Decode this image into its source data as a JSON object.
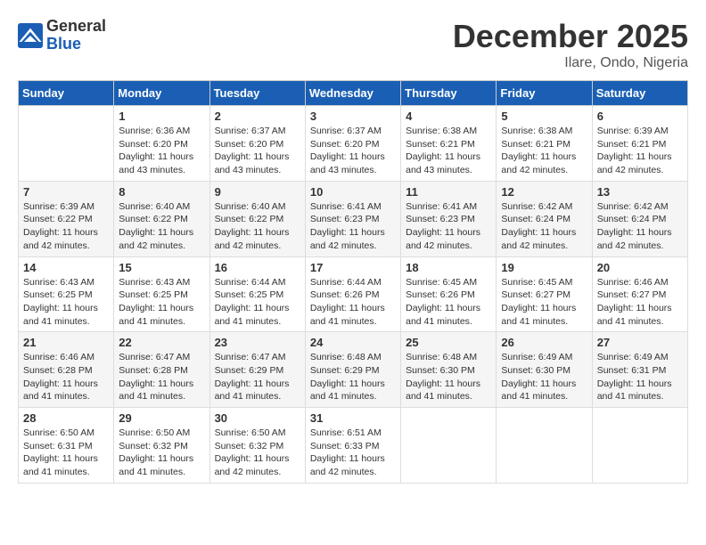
{
  "logo": {
    "general": "General",
    "blue": "Blue"
  },
  "title": "December 2025",
  "location": "Ilare, Ondo, Nigeria",
  "days_of_week": [
    "Sunday",
    "Monday",
    "Tuesday",
    "Wednesday",
    "Thursday",
    "Friday",
    "Saturday"
  ],
  "weeks": [
    [
      {
        "day": "",
        "info": ""
      },
      {
        "day": "1",
        "info": "Sunrise: 6:36 AM\nSunset: 6:20 PM\nDaylight: 11 hours\nand 43 minutes."
      },
      {
        "day": "2",
        "info": "Sunrise: 6:37 AM\nSunset: 6:20 PM\nDaylight: 11 hours\nand 43 minutes."
      },
      {
        "day": "3",
        "info": "Sunrise: 6:37 AM\nSunset: 6:20 PM\nDaylight: 11 hours\nand 43 minutes."
      },
      {
        "day": "4",
        "info": "Sunrise: 6:38 AM\nSunset: 6:21 PM\nDaylight: 11 hours\nand 43 minutes."
      },
      {
        "day": "5",
        "info": "Sunrise: 6:38 AM\nSunset: 6:21 PM\nDaylight: 11 hours\nand 42 minutes."
      },
      {
        "day": "6",
        "info": "Sunrise: 6:39 AM\nSunset: 6:21 PM\nDaylight: 11 hours\nand 42 minutes."
      }
    ],
    [
      {
        "day": "7",
        "info": "Sunrise: 6:39 AM\nSunset: 6:22 PM\nDaylight: 11 hours\nand 42 minutes."
      },
      {
        "day": "8",
        "info": "Sunrise: 6:40 AM\nSunset: 6:22 PM\nDaylight: 11 hours\nand 42 minutes."
      },
      {
        "day": "9",
        "info": "Sunrise: 6:40 AM\nSunset: 6:22 PM\nDaylight: 11 hours\nand 42 minutes."
      },
      {
        "day": "10",
        "info": "Sunrise: 6:41 AM\nSunset: 6:23 PM\nDaylight: 11 hours\nand 42 minutes."
      },
      {
        "day": "11",
        "info": "Sunrise: 6:41 AM\nSunset: 6:23 PM\nDaylight: 11 hours\nand 42 minutes."
      },
      {
        "day": "12",
        "info": "Sunrise: 6:42 AM\nSunset: 6:24 PM\nDaylight: 11 hours\nand 42 minutes."
      },
      {
        "day": "13",
        "info": "Sunrise: 6:42 AM\nSunset: 6:24 PM\nDaylight: 11 hours\nand 42 minutes."
      }
    ],
    [
      {
        "day": "14",
        "info": "Sunrise: 6:43 AM\nSunset: 6:25 PM\nDaylight: 11 hours\nand 41 minutes."
      },
      {
        "day": "15",
        "info": "Sunrise: 6:43 AM\nSunset: 6:25 PM\nDaylight: 11 hours\nand 41 minutes."
      },
      {
        "day": "16",
        "info": "Sunrise: 6:44 AM\nSunset: 6:25 PM\nDaylight: 11 hours\nand 41 minutes."
      },
      {
        "day": "17",
        "info": "Sunrise: 6:44 AM\nSunset: 6:26 PM\nDaylight: 11 hours\nand 41 minutes."
      },
      {
        "day": "18",
        "info": "Sunrise: 6:45 AM\nSunset: 6:26 PM\nDaylight: 11 hours\nand 41 minutes."
      },
      {
        "day": "19",
        "info": "Sunrise: 6:45 AM\nSunset: 6:27 PM\nDaylight: 11 hours\nand 41 minutes."
      },
      {
        "day": "20",
        "info": "Sunrise: 6:46 AM\nSunset: 6:27 PM\nDaylight: 11 hours\nand 41 minutes."
      }
    ],
    [
      {
        "day": "21",
        "info": "Sunrise: 6:46 AM\nSunset: 6:28 PM\nDaylight: 11 hours\nand 41 minutes."
      },
      {
        "day": "22",
        "info": "Sunrise: 6:47 AM\nSunset: 6:28 PM\nDaylight: 11 hours\nand 41 minutes."
      },
      {
        "day": "23",
        "info": "Sunrise: 6:47 AM\nSunset: 6:29 PM\nDaylight: 11 hours\nand 41 minutes."
      },
      {
        "day": "24",
        "info": "Sunrise: 6:48 AM\nSunset: 6:29 PM\nDaylight: 11 hours\nand 41 minutes."
      },
      {
        "day": "25",
        "info": "Sunrise: 6:48 AM\nSunset: 6:30 PM\nDaylight: 11 hours\nand 41 minutes."
      },
      {
        "day": "26",
        "info": "Sunrise: 6:49 AM\nSunset: 6:30 PM\nDaylight: 11 hours\nand 41 minutes."
      },
      {
        "day": "27",
        "info": "Sunrise: 6:49 AM\nSunset: 6:31 PM\nDaylight: 11 hours\nand 41 minutes."
      }
    ],
    [
      {
        "day": "28",
        "info": "Sunrise: 6:50 AM\nSunset: 6:31 PM\nDaylight: 11 hours\nand 41 minutes."
      },
      {
        "day": "29",
        "info": "Sunrise: 6:50 AM\nSunset: 6:32 PM\nDaylight: 11 hours\nand 41 minutes."
      },
      {
        "day": "30",
        "info": "Sunrise: 6:50 AM\nSunset: 6:32 PM\nDaylight: 11 hours\nand 42 minutes."
      },
      {
        "day": "31",
        "info": "Sunrise: 6:51 AM\nSunset: 6:33 PM\nDaylight: 11 hours\nand 42 minutes."
      },
      {
        "day": "",
        "info": ""
      },
      {
        "day": "",
        "info": ""
      },
      {
        "day": "",
        "info": ""
      }
    ]
  ]
}
